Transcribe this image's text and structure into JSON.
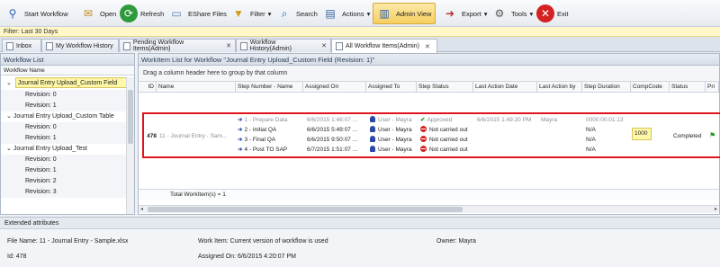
{
  "toolbar": {
    "start_workflow": "Start Workflow",
    "open": "Open",
    "refresh": "Refresh",
    "eshare_files": "EShare Files",
    "filter": "Filter",
    "search": "Search",
    "actions": "Actions",
    "admin_view": "Admin View",
    "export": "Export",
    "tools": "Tools",
    "exit": "Exit"
  },
  "filter_text": "Filter: Last 30 Days",
  "tabs": [
    {
      "label": "Inbox"
    },
    {
      "label": "My Workflow History"
    },
    {
      "label": "Pending Workflow Items(Admin)"
    },
    {
      "label": "Workflow History(Admin)"
    },
    {
      "label": "All Workflow Items(Admin)"
    }
  ],
  "workflow_list": {
    "title": "Workflow List",
    "column": "Workflow Name",
    "items": [
      {
        "label": "Journal Entry Upload_Custom Field"
      },
      {
        "label": "Revision: 0"
      },
      {
        "label": "Revision: 1"
      },
      {
        "label": "Journal Entry Upload_Custom Table"
      },
      {
        "label": "Revision: 0"
      },
      {
        "label": "Revision: 1"
      },
      {
        "label": "Journal Entry Upload_Test"
      },
      {
        "label": "Revision: 0"
      },
      {
        "label": "Revision: 1"
      },
      {
        "label": "Revision: 2"
      },
      {
        "label": "Revision: 3"
      }
    ]
  },
  "worklist": {
    "title": "WorkItem List for Workflow \"Journal Entry Upload_Custom Field (Revision: 1)\"",
    "group_hint": "Drag a column header here to group by that column",
    "columns": [
      "ID",
      "Name",
      "Step Number - Name",
      "Assigned On",
      "Assigned To",
      "Step Status",
      "Last Action Date",
      "Last Action by",
      "Step Duration",
      "CompCode",
      "Status",
      "Pri"
    ],
    "item": {
      "id": "478",
      "name": "11 - Journal Entry - Sam...",
      "comp_code": "1000",
      "status": "Completed"
    },
    "steps": [
      {
        "step": "1 - Prepare Data",
        "assigned_on": "6/6/2015 1:48:07 ...",
        "assigned_to": "User - Mayra",
        "status": "Approved",
        "last_action_date": "6/6/2015 1:49:20 PM",
        "last_action_by": "Mayra",
        "duration": "0000:00:01:13"
      },
      {
        "step": "2 - Initial QA",
        "assigned_on": "6/6/2015 5:49:07 ...",
        "assigned_to": "User - Mayra",
        "status": "Not carried out",
        "last_action_date": "",
        "last_action_by": "",
        "duration": "N/A"
      },
      {
        "step": "3 - Final QA",
        "assigned_on": "6/6/2015 9:50:07 ...",
        "assigned_to": "User - Mayra",
        "status": "Not carried out",
        "last_action_date": "",
        "last_action_by": "",
        "duration": "N/A"
      },
      {
        "step": "4 - Post TO SAP",
        "assigned_on": "6/7/2015 1:51:07 ...",
        "assigned_to": "User - Mayra",
        "status": "Not carried out",
        "last_action_date": "",
        "last_action_by": "",
        "duration": "N/A"
      }
    ],
    "total": "Total WorkItem(s) = 1"
  },
  "extended": {
    "title": "Extended attributes",
    "file_name": "File Name: 11 - Journal Entry - Sample.xlsx",
    "work_item": "Work Item: Current version of workflow is used",
    "owner": "Owner: Mayra",
    "id": "Id: 478",
    "assigned_on": "Assigned On: 6/6/2015 4:20:07 PM"
  }
}
